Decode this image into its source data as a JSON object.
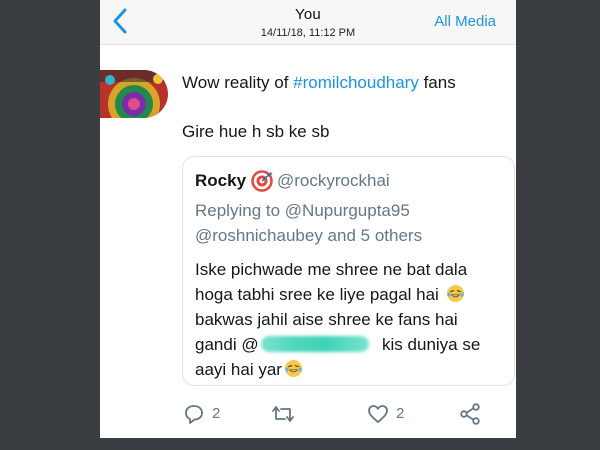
{
  "header": {
    "title": "You",
    "timestamp": "14/11/18, 11:12 PM",
    "right_link": "All Media"
  },
  "tweet": {
    "text_before_hashtag": "Wow reality of ",
    "hashtag": "#romilchoudhary",
    "text_after_hashtag": " fans",
    "second_line": "Gire hue h sb ke sb"
  },
  "quoted": {
    "name": "Rocky",
    "badge_icon": "target-emoji",
    "handle": "@rockyrockhai",
    "replying_prefix": "Replying to ",
    "replying_user": "@Nupurgupta95",
    "replying_line2": "@roshnichaubey and 5 others",
    "body_line1": "Iske pichwade me shree ne bat dala",
    "body_line2": "hoga tabhi sree ke liye pagal hai",
    "body_line3": "bakwas jahil aise shree ke fans hai",
    "body_line4_start": "gandi @",
    "body_line4_end": "kis duniya se",
    "body_line5": "aayi hai yar",
    "emoji": "laughing-tears-emoji"
  },
  "actions": {
    "reply_count": "2",
    "retweet_count": "",
    "like_count": "2"
  },
  "colors": {
    "link_blue": "#1b95e0",
    "secondary_gray": "#657786",
    "text_dark": "#14171a",
    "background_dark": "#3a3d41"
  }
}
